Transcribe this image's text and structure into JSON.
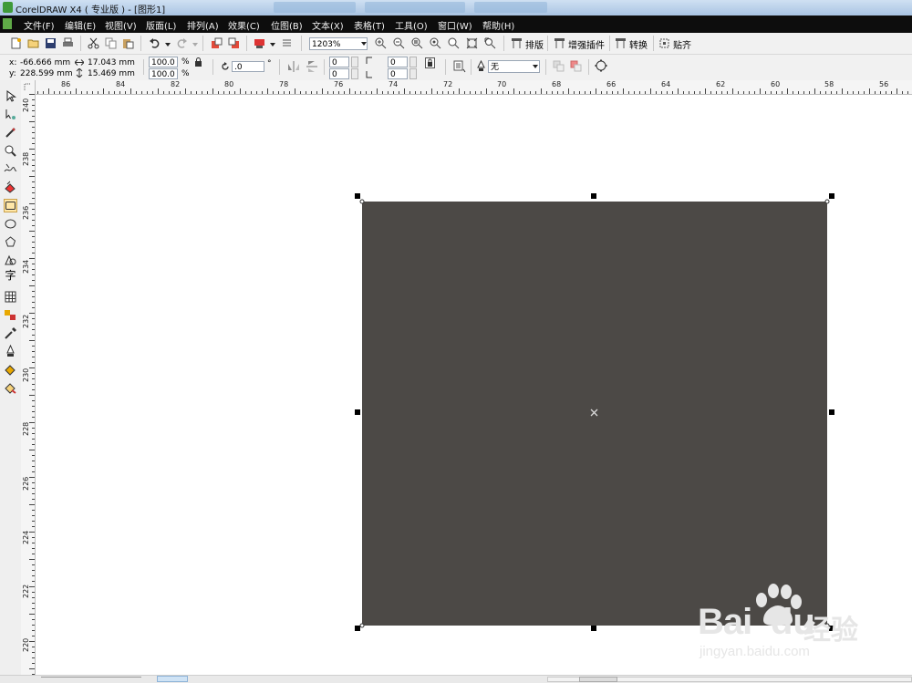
{
  "window": {
    "title": "CorelDRAW X4 ( 专业版 ) - [图形1]"
  },
  "menubar": {
    "items": [
      "文件(F)",
      "编辑(E)",
      "视图(V)",
      "版面(L)",
      "排列(A)",
      "效果(C)",
      "位图(B)",
      "文本(X)",
      "表格(T)",
      "工具(O)",
      "窗口(W)",
      "帮助(H)"
    ]
  },
  "standard_toolbar": {
    "zoom_level": "1203%",
    "plugin_buttons": [
      "排版",
      "增强插件",
      "转换",
      "贴齐"
    ]
  },
  "property_bar": {
    "x_label": "x:",
    "x_value": "-66.666 mm",
    "y_label": "y:",
    "y_value": "228.599 mm",
    "width_value": "17.043 mm",
    "height_value": "15.469 mm",
    "scale_x": "100.0",
    "scale_y": "100.0",
    "percent_sign": "%",
    "rotation_value": ".0",
    "degree_sign": "°",
    "corner_values": [
      "0",
      "0",
      "0",
      "0"
    ],
    "outline_value": "无"
  },
  "rulers": {
    "horizontal_labels": [
      "86",
      "84",
      "82",
      "80",
      "78",
      "76",
      "74",
      "72",
      "70",
      "68",
      "66",
      "64",
      "62",
      "60",
      "58",
      "56"
    ],
    "vertical_labels": [
      "240",
      "238",
      "236",
      "234",
      "232",
      "230",
      "228",
      "226",
      "224",
      "222",
      "220"
    ]
  },
  "toolbox": {
    "tools": [
      "pick-tool",
      "shape-tool",
      "crop-tool",
      "zoom-tool",
      "freehand-tool",
      "smart-fill-tool",
      "rectangle-tool",
      "ellipse-tool",
      "polygon-tool",
      "basic-shapes-tool",
      "text-tool",
      "table-tool",
      "interactive-blend-tool",
      "eyedropper-tool",
      "outline-tool",
      "fill-tool",
      "interactive-fill-tool"
    ],
    "text_tool_glyph": "字",
    "active_tool": "rectangle-tool"
  },
  "document": {
    "selected_shape": "rectangle",
    "fill_color": "#4c4946"
  },
  "watermark": {
    "brand": "Bai",
    "brand_suffix": "du",
    "cn_text": "经验",
    "url": "jingyan.baidu.com"
  }
}
